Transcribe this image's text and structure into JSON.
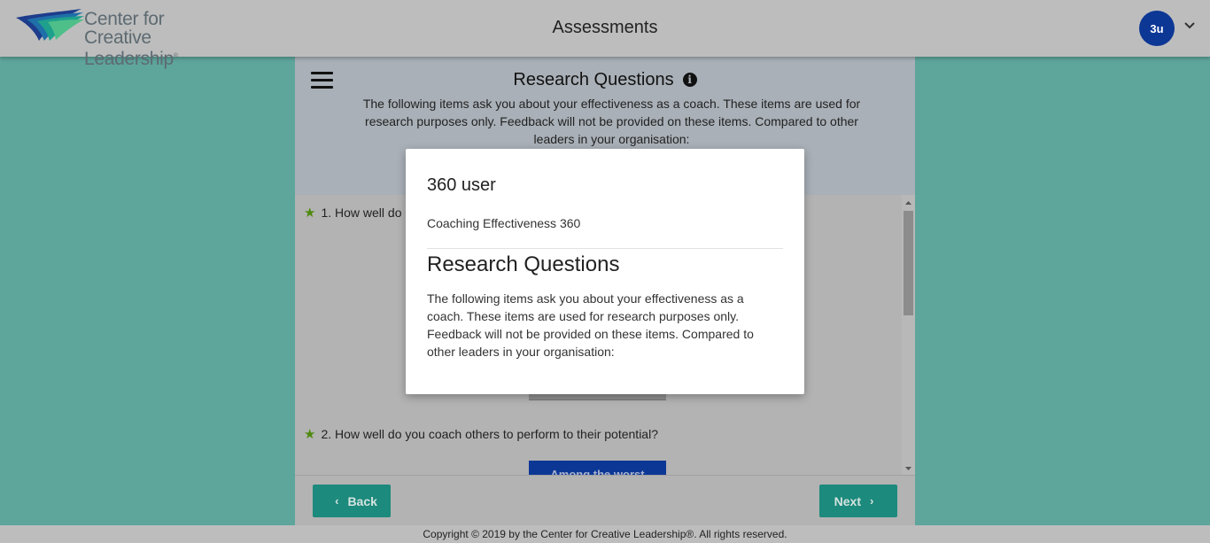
{
  "header": {
    "logo_line1": "Center for",
    "logo_line2": "Creative Leadership",
    "title": "Assessments",
    "avatar_initials": "3u"
  },
  "section": {
    "title": "Research Questions",
    "description": "The following items ask you about your effectiveness as a coach. These items are used for research purposes only. Feedback will not be provided on these items. Compared to other leaders in your organisation:"
  },
  "questions": [
    {
      "label": "1. How well do"
    },
    {
      "label": "2. How well do you coach others to perform to their potential?",
      "answer_label": "Among the worst"
    }
  ],
  "nav": {
    "back_label": "Back",
    "next_label": "Next"
  },
  "footer": {
    "copyright": "Copyright © 2019 by the Center for Creative Leadership®. All rights reserved."
  },
  "modal": {
    "user": "360 user",
    "assessment": "Coaching Effectiveness 360",
    "title": "Research Questions",
    "description": "The following items ask you about your effectiveness as a coach. These items are used for research purposes only. Feedback will not be provided on these items. Compared to other leaders in your organisation:"
  },
  "colors": {
    "background": "#5ea59c",
    "header": "#bdbdbd",
    "primary_button": "#1c8a7c",
    "avatar": "#0c3795",
    "star": "#4f8a10"
  }
}
